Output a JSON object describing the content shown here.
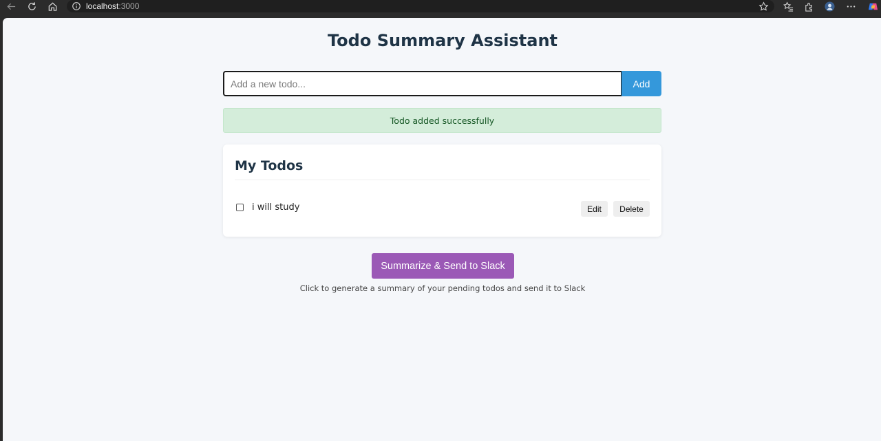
{
  "browser": {
    "url_host": "localhost",
    "url_port": ":3000",
    "icons": [
      "back-icon",
      "refresh-icon",
      "home-icon",
      "info-icon",
      "favorite-star-icon",
      "favorites-icon",
      "extensions-icon",
      "profile-icon",
      "more-icon",
      "copilot-icon"
    ]
  },
  "app": {
    "title": "Todo Summary Assistant",
    "input_placeholder": "Add a new todo...",
    "input_value": "",
    "add_label": "Add",
    "alert": "Todo added successfully",
    "list_title": "My Todos",
    "todos": [
      {
        "text": "i will study",
        "completed": false,
        "edit_label": "Edit",
        "delete_label": "Delete"
      }
    ],
    "summarize_label": "Summarize & Send to Slack",
    "helper_text": "Click to generate a summary of your pending todos and send it to Slack"
  },
  "colors": {
    "accent_blue": "#3498db",
    "accent_purple": "#9b59b6",
    "alert_bg": "#d4edda",
    "alert_text": "#155724",
    "heading": "#1f3446",
    "page_bg": "#f5f7fa"
  }
}
